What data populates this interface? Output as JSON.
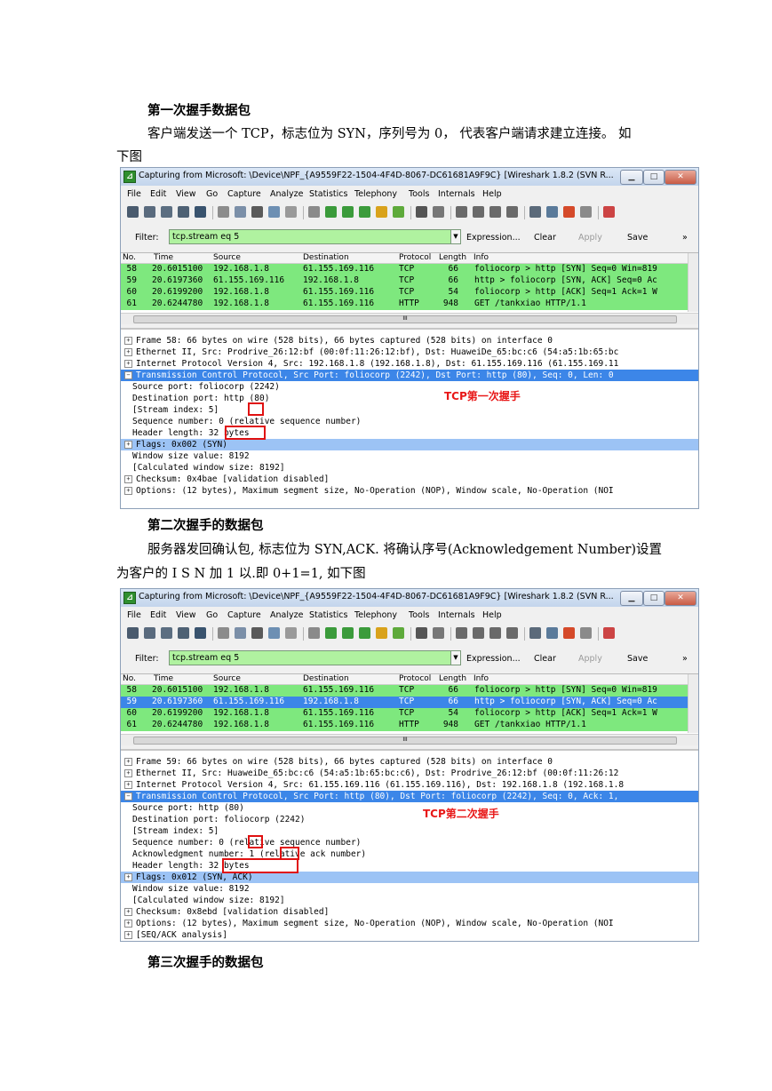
{
  "doc": {
    "heading1": "第一次握手数据包",
    "para1_line1": "客户端发送一个 TCP，标志位为 SYN，序列号为 0，  代表客户端请求建立连接。 如",
    "para1_line2": "下图",
    "heading2": "第二次握手的数据包",
    "para2_line1": "服务器发回确认包, 标志位为  SYN,ACK.  将确认序号(Acknowledgement Number)设置",
    "para2_line2": "为客户的 I S N 加 1 以.即 0+1=1, 如下图",
    "heading3": "第三次握手的数据包"
  },
  "window": {
    "title": "Capturing from Microsoft: \\Device\\NPF_{A9559F22-1504-4F4D-8067-DC61681A9F9C}   [Wireshark 1.8.2  (SVN R...",
    "menu": [
      "File",
      "Edit",
      "View",
      "Go",
      "Capture",
      "Analyze",
      "Statistics",
      "Telephony",
      "Tools",
      "Internals",
      "Help"
    ],
    "filter_label": "Filter:",
    "filter_value": "tcp.stream eq 5",
    "filter_buttons": [
      "Expression...",
      "Clear",
      "Apply",
      "Save"
    ],
    "more_glyph": "»",
    "columns": [
      "No.",
      "Time",
      "Source",
      "Destination",
      "Protocol",
      "Length",
      "Info"
    ],
    "packets": [
      {
        "no": "58",
        "time": "20.6015100",
        "src": "192.168.1.8",
        "dst": "61.155.169.116",
        "proto": "TCP",
        "len": "66",
        "info": "foliocorp > http [SYN] Seq=0 Win=819"
      },
      {
        "no": "59",
        "time": "20.6197360",
        "src": "61.155.169.116",
        "dst": "192.168.1.8",
        "proto": "TCP",
        "len": "66",
        "info": "http > foliocorp [SYN, ACK] Seq=0 Ac"
      },
      {
        "no": "60",
        "time": "20.6199200",
        "src": "192.168.1.8",
        "dst": "61.155.169.116",
        "proto": "TCP",
        "len": "54",
        "info": "foliocorp > http [ACK] Seq=1 Ack=1 W"
      },
      {
        "no": "61",
        "time": "20.6244780",
        "src": "192.168.1.8",
        "dst": "61.155.169.116",
        "proto": "HTTP",
        "len": "948",
        "info": "GET /tankxiao HTTP/1.1"
      }
    ],
    "colors": {
      "green_row": "#7ee87e",
      "selected_row": "#3c86e8",
      "highlight": "#9cc3f5",
      "annotation": "#e81818"
    }
  },
  "shot1": {
    "details": [
      "Frame 58: 66 bytes on wire (528 bits), 66 bytes captured (528 bits) on interface 0",
      "Ethernet II, Src: Prodrive_26:12:bf (00:0f:11:26:12:bf), Dst: HuaweiDe_65:bc:c6 (54:a5:1b:65:bc",
      "Internet Protocol Version 4, Src: 192.168.1.8 (192.168.1.8), Dst: 61.155.169.116 (61.155.169.11",
      "Transmission Control Protocol, Src Port: foliocorp (2242), Dst Port: http (80), Seq: 0, Len: 0",
      "Source port: foliocorp (2242)",
      "Destination port: http (80)",
      "[Stream index: 5]",
      "Sequence number: 0    (relative sequence number)",
      "Header length: 32 bytes",
      "Flags: 0x002 (SYN)",
      "Window size value: 8192",
      "[Calculated window size: 8192]",
      "Checksum: 0x4bae [validation disabled]",
      "Options: (12 bytes), Maximum segment size, No-Operation (NOP), Window scale, No-Operation (NOI"
    ],
    "annotation": "TCP第一次握手"
  },
  "shot2": {
    "details": [
      "Frame 59: 66 bytes on wire (528 bits), 66 bytes captured (528 bits) on interface 0",
      "Ethernet II, Src: HuaweiDe_65:bc:c6 (54:a5:1b:65:bc:c6), Dst: Prodrive_26:12:bf (00:0f:11:26:12",
      "Internet Protocol Version 4, Src: 61.155.169.116 (61.155.169.116), Dst: 192.168.1.8 (192.168.1.8",
      "Transmission Control Protocol, Src Port: http (80), Dst Port: foliocorp (2242), Seq: 0, Ack: 1,",
      "Source port: http (80)",
      "Destination port: foliocorp (2242)",
      "[Stream index: 5]",
      "Sequence number: 0    (relative sequence number)",
      "Acknowledgment number: 1    (relative ack number)",
      "Header length: 32 bytes",
      "Flags: 0x012 (SYN, ACK)",
      "Window size value: 8192",
      "[Calculated window size: 8192]",
      "Checksum: 0x8ebd [validation disabled]",
      "Options: (12 bytes), Maximum segment size, No-Operation (NOP), Window scale, No-Operation (NOI",
      "[SEQ/ACK analysis]"
    ],
    "annotation": "TCP第二次握手"
  }
}
